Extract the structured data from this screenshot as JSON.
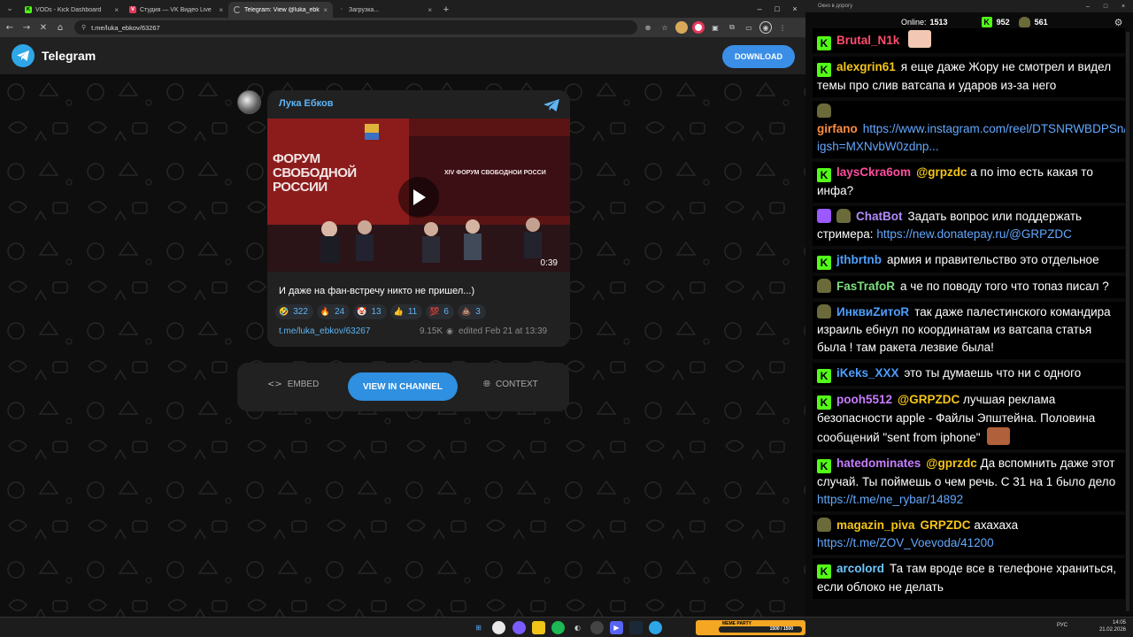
{
  "browser": {
    "tabs": [
      {
        "title": "VODs - Kick Dashboard",
        "fav_color": "#53fc18",
        "fav_letter": "K"
      },
      {
        "title": "Студия — VK Видео Live",
        "fav_color": "#e5365c",
        "fav_letter": "V"
      },
      {
        "title": "Telegram: View @luka_ebkov",
        "fav_color": "#2ea6e8",
        "fav_letter": ""
      },
      {
        "title": "Загрузка...",
        "fav_color": "#555555",
        "fav_letter": ""
      }
    ],
    "url": "t.me/luka_ebkov/63267"
  },
  "telegram": {
    "brand": "Telegram",
    "download_label": "DOWNLOAD",
    "post": {
      "author": "Лука Ебков",
      "video_duration": "0:39",
      "video_banner_text": "ФОРУМ СВОБОДНОЙ РОССИИ",
      "video_side_text": "XIV ФОРУМ СВОБОДНОЙ РОССИ",
      "text": "И даже на фан-встречу никто не пришел...)",
      "reactions": [
        {
          "icon": "🤣",
          "count": "322"
        },
        {
          "icon": "🔥",
          "count": "24"
        },
        {
          "icon": "🤡",
          "count": "13"
        },
        {
          "icon": "👍",
          "count": "11"
        },
        {
          "icon": "💯",
          "count": "6"
        },
        {
          "icon": "💩",
          "count": "3"
        }
      ],
      "link": "t.me/luka_ebkov/63267",
      "views": "9.15K",
      "edited": "edited  Feb 21 at 13:39"
    },
    "actions": {
      "embed": "EMBED",
      "view_in_channel": "VIEW IN CHANNEL",
      "context": "CONTEXT"
    }
  },
  "chat": {
    "window_title": "Окно в дорогу",
    "online_label": "Online:",
    "online_count": "1513",
    "kick_count": "952",
    "other_count": "561",
    "messages": [
      {
        "badge": "k",
        "user": "Brutal_N1k",
        "color": "#ff4d6d",
        "mention": "",
        "text": "",
        "link": "",
        "emote": true
      },
      {
        "badge": "k",
        "user": "alexgrin61",
        "color": "#f5c518",
        "mention": "",
        "text": "я еще даже Жору не смотрел и видел темы про слив ватсапа и ударов из-за него",
        "link": "",
        "emote": false
      },
      {
        "badge": "b",
        "user": "girfano",
        "color": "#ff8c42",
        "mention": "",
        "text": "",
        "link": "https://www.instagram.com/reel/DTSNRWBDPSn/?igsh=MXNvbW0zdnp...",
        "emote": false
      },
      {
        "badge": "k",
        "user": "laysCkra6om",
        "color": "#ff4d9e",
        "mention": "@grpzdc",
        "text": "а по imo есть какая то инфа?",
        "link": "",
        "emote": false
      },
      {
        "badge": "c",
        "user": "ChatBot",
        "color": "#b48cff",
        "mention": "",
        "text": "Задать вопрос или поддержать стримера:",
        "link": "https://new.donatepay.ru/@GRPZDC",
        "emote": false
      },
      {
        "badge": "k",
        "user": "jthbrtnb",
        "color": "#4d9fff",
        "mention": "",
        "text": "армия и правительство это отдельное",
        "link": "",
        "emote": false
      },
      {
        "badge": "b",
        "user": "FasTrafoR",
        "color": "#7ee07e",
        "mention": "",
        "text": "а че по поводу того что топаз писал ?",
        "link": "",
        "emote": false
      },
      {
        "badge": "b",
        "user": "ИнквиZитоR",
        "color": "#4d9fff",
        "mention": "",
        "text": "так даже палестинского командира израиль ебнул по координатам из ватсапа статья была ! там ракета лезвие была!",
        "link": "",
        "emote": false
      },
      {
        "badge": "k",
        "user": "iKeks_XXX",
        "color": "#4d9fff",
        "mention": "",
        "text": "это ты думаешь что ни с одного",
        "link": "",
        "emote": false
      },
      {
        "badge": "k",
        "user": "pooh5512",
        "color": "#c77dff",
        "mention": "@GRPZDC",
        "text": "лучшая реклама безопасности apple - Файлы Эпштейна. Половина сообщений \"sent from iphone\"",
        "link": "",
        "emote": true
      },
      {
        "badge": "k",
        "user": "hatedominates",
        "color": "#c77dff",
        "mention": "@gprzdc",
        "text": "Да вспомнить даже этот случай. Ты поймешь о чем речь. С 31 на 1 было дело",
        "link": "https://t.me/ne_rybar/14892",
        "emote": false
      },
      {
        "badge": "b",
        "user": "magazin_piva",
        "color": "#f5c518",
        "mention": "GRPZDC",
        "text": "ахахаха",
        "link": "https://t.me/ZOV_Voevoda/41200",
        "emote": false
      },
      {
        "badge": "k",
        "user": "arcolord",
        "color": "#6ec6ff",
        "mention": "",
        "text": "Та там вроде все в телефоне храниться, если облоко не делать",
        "link": "",
        "emote": false
      }
    ]
  },
  "taskbar": {
    "widget_title": "MEME PARTY",
    "widget_progress": "1500 / 1500",
    "lang": "РУС",
    "time": "14:05",
    "date": "21.02.2026"
  }
}
